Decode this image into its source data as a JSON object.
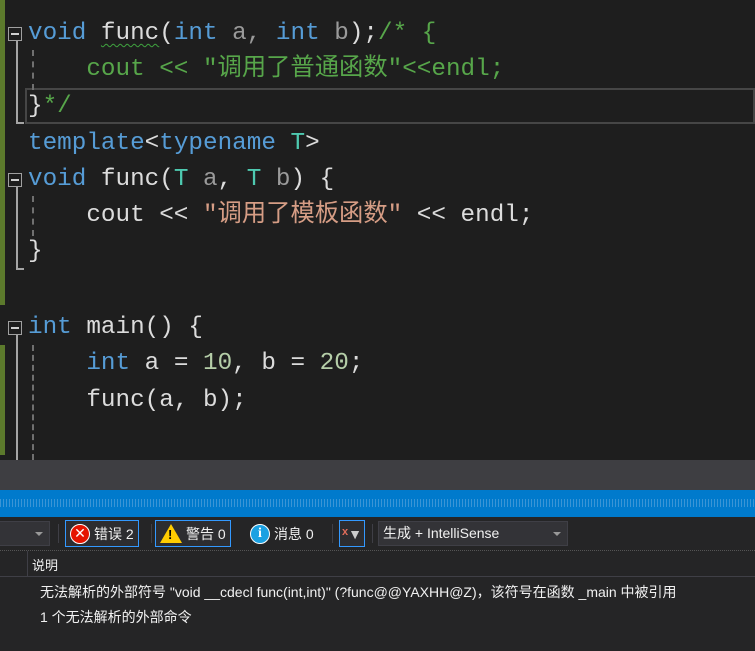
{
  "code_lines": [
    [
      [
        "void",
        "kw"
      ],
      [
        " ",
        "tx"
      ],
      [
        "func",
        "tx squig"
      ],
      [
        "(",
        "tx"
      ],
      [
        "int",
        "kw"
      ],
      [
        " a, ",
        "pm"
      ],
      [
        "int",
        "kw"
      ],
      [
        " b",
        "pm"
      ],
      [
        ");",
        "tx"
      ],
      [
        "/* {",
        "cm"
      ]
    ],
    [
      [
        "    cout << \"调用了普通函数\"<<endl;",
        "cm"
      ]
    ],
    [
      [
        "}",
        "tx"
      ],
      [
        "*/",
        "cm"
      ]
    ],
    [
      [
        "template",
        "kw"
      ],
      [
        "<",
        "tx"
      ],
      [
        "typename",
        "kw"
      ],
      [
        " ",
        "tx"
      ],
      [
        "T",
        "ty"
      ],
      [
        ">",
        "tx"
      ]
    ],
    [
      [
        "void",
        "kw"
      ],
      [
        " func(",
        "tx"
      ],
      [
        "T",
        "ty"
      ],
      [
        " a",
        "pm"
      ],
      [
        ", ",
        "tx"
      ],
      [
        "T",
        "ty"
      ],
      [
        " b",
        "pm"
      ],
      [
        ") {",
        "tx"
      ]
    ],
    [
      [
        "    cout << ",
        "tx"
      ],
      [
        "\"调用了模板函数\"",
        "st"
      ],
      [
        " << endl;",
        "tx"
      ]
    ],
    [
      [
        "}",
        "tx"
      ]
    ],
    [],
    [
      [
        "int",
        "kw"
      ],
      [
        " main() {",
        "tx"
      ]
    ],
    [
      [
        "    ",
        "tx"
      ],
      [
        "int",
        "kw"
      ],
      [
        " a = ",
        "tx"
      ],
      [
        "10",
        "nu"
      ],
      [
        ", b = ",
        "tx"
      ],
      [
        "20",
        "nu"
      ],
      [
        ";",
        "tx"
      ]
    ],
    [
      [
        "    func(a, b);",
        "tx"
      ]
    ]
  ],
  "toolbar": {
    "errors_label": "错误 2",
    "warnings_label": "警告 0",
    "messages_label": "消息 0",
    "build_filter": "生成 + IntelliSense"
  },
  "error_list": {
    "column_description": "说明",
    "rows": [
      "无法解析的外部符号 \"void __cdecl func(int,int)\" (?func@@YAXHH@Z)，该符号在函数 _main 中被引用",
      "1 个无法解析的外部命令"
    ]
  },
  "colors": {
    "keyword": "#569cd6",
    "comment": "#57a64a",
    "string": "#d69d85",
    "type": "#4ec9b0",
    "number": "#b5cea8",
    "accent": "#007acc"
  }
}
